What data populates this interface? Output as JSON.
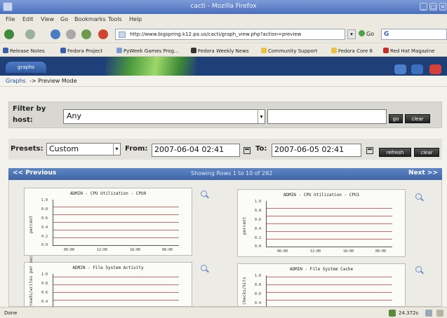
{
  "window": {
    "title": "cacti - Mozilla Firefox"
  },
  "menu": [
    "File",
    "Edit",
    "View",
    "Go",
    "Bookmarks",
    "Tools",
    "Help"
  ],
  "nav": {
    "url": "http://www.bigspring.k12.pa.us/cacti/graph_view.php?action=preview",
    "go_label": "Go"
  },
  "bookmarks": [
    {
      "label": "Release Notes",
      "color": "#3b5ca8"
    },
    {
      "label": "Fedora Project",
      "color": "#3b5ca8"
    },
    {
      "label": "PyWeek Games Prog...",
      "color": "#7a9ccf"
    },
    {
      "label": "Fedora Weekly News",
      "color": "#333333"
    },
    {
      "label": "Community Support",
      "color": "#e8c14a"
    },
    {
      "label": "Fedora Core 6",
      "color": "#e8c14a"
    },
    {
      "label": "Red Hat Magazine",
      "color": "#c0302a"
    }
  ],
  "cacti": {
    "tab_label": "graphs",
    "breadcrumb_link": "Graphs",
    "breadcrumb_arrow": "->",
    "breadcrumb_current": "Preview Mode"
  },
  "filter": {
    "label": "Filter by host:",
    "host_value": "Any",
    "go_button": "go",
    "clear_button": "clear"
  },
  "presets": {
    "label": "Presets:",
    "value": "Custom",
    "from_label": "From:",
    "from_value": "2007-06-04 02:41",
    "to_label": "To:",
    "to_value": "2007-06-05 02:41",
    "refresh_button": "refresh",
    "clear_button": "clear"
  },
  "table_nav": {
    "previous": "<< Previous",
    "showing": "Showing Rows 1 to 10 of 282",
    "next": "Next >>"
  },
  "graphs": [
    {
      "title": "ADMIN - CPU Utilization - CPU0",
      "ylabel": "percent",
      "yticks": [
        "1.0",
        "0.8",
        "0.6",
        "0.4",
        "0.2",
        "0.0"
      ],
      "xticks": [
        "06:00",
        "12:00",
        "18:00",
        "00:00"
      ]
    },
    {
      "title": "ADMIN - CPU Utilization - CPU1",
      "ylabel": "percent",
      "yticks": [
        "1.0",
        "0.8",
        "0.6",
        "0.4",
        "0.2",
        "0.0"
      ],
      "xticks": [
        "06:00",
        "12:00",
        "18:00",
        "00:00"
      ]
    },
    {
      "title": "ADMIN - File System Activity",
      "ylabel": "reads/writes per sec",
      "yticks": [
        "1.0",
        "0.8",
        "0.6",
        "0.4"
      ],
      "xticks": []
    },
    {
      "title": "ADMIN - File System Cache",
      "ylabel": "checks/hits",
      "yticks": [
        "1.0",
        "0.8",
        "0.6",
        "0.4"
      ],
      "xticks": []
    }
  ],
  "status": {
    "left": "Done",
    "right": "24.372s"
  }
}
